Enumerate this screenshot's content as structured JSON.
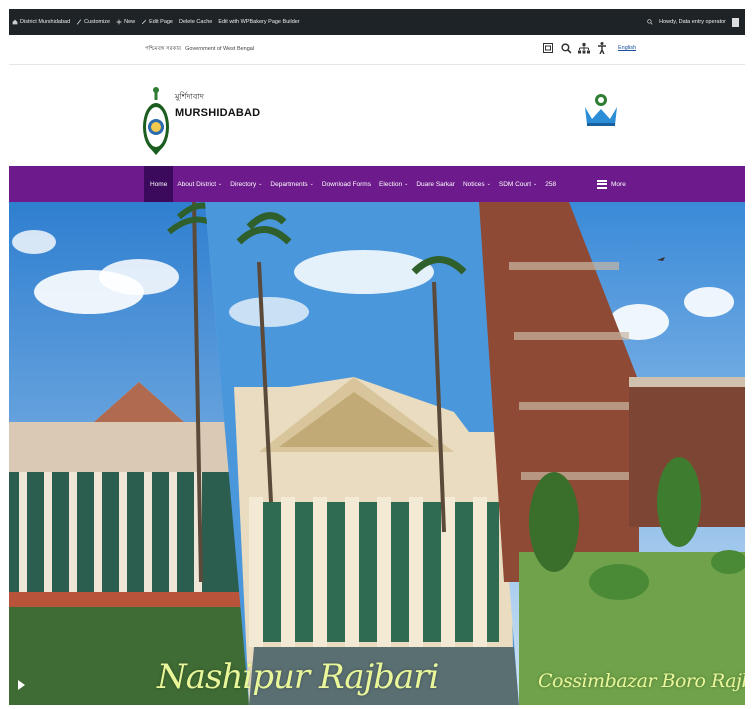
{
  "adminbar": {
    "site": "District Murshidabad",
    "customize": "Customize",
    "new": "New",
    "edit_page": "Edit Page",
    "delete_cache": "Delete Cache",
    "wpbakery": "Edit with WPBakery Page Builder",
    "howdy": "Howdy, Data entry operator"
  },
  "topstrip": {
    "govt_bn": "পশ্চিমবঙ্গ সরকার",
    "govt_en": "Government of West Bengal",
    "language": "English"
  },
  "header": {
    "district_bn": "মুর্শিদাবাদ",
    "district_en": "MURSHIDABAD"
  },
  "nav": {
    "items": [
      {
        "label": "Home",
        "has_menu": false
      },
      {
        "label": "About District",
        "has_menu": true
      },
      {
        "label": "Directory",
        "has_menu": true
      },
      {
        "label": "Departments",
        "has_menu": true
      },
      {
        "label": "Download Forms",
        "has_menu": false
      },
      {
        "label": "Election",
        "has_menu": true
      },
      {
        "label": "Duare Sarkar",
        "has_menu": false
      },
      {
        "label": "Notices",
        "has_menu": true
      },
      {
        "label": "SDM Court",
        "has_menu": true
      },
      {
        "label": "258",
        "has_menu": false
      }
    ],
    "more": "More",
    "chevron": "⌄"
  },
  "hero": {
    "caption_1": "Nashipur Rajbari",
    "caption_2": "Cossimbazar Boro Rajbari"
  },
  "colors": {
    "nav_bg": "#6d1b8c",
    "nav_active": "#3b0a5c",
    "adminbar_bg": "#1d2327",
    "caption": "#e9f79a"
  }
}
